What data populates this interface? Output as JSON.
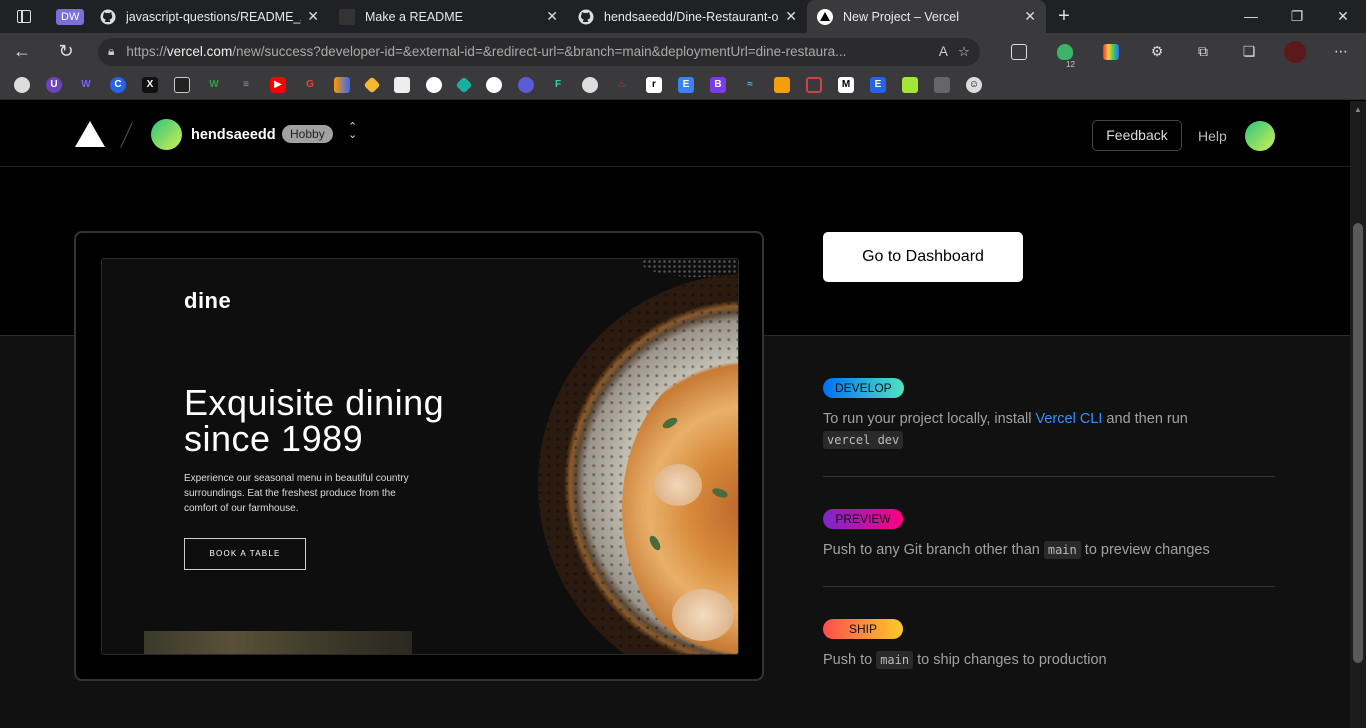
{
  "browser": {
    "tabs": [
      {
        "label": "DW",
        "kind": "workspace"
      },
      {
        "label": "javascript-questions/README_AR",
        "icon": "github-icon"
      },
      {
        "label": "Make a README",
        "icon": "page-icon"
      },
      {
        "label": "hendsaeedd/Dine-Restaurant-on",
        "icon": "github-icon"
      },
      {
        "label": "New Project – Vercel",
        "icon": "vercel-icon",
        "active": true
      }
    ],
    "url_prefix": "https://",
    "url_host": "vercel.com",
    "url_rest": "/new/success?developer-id=&external-id=&redirect-url=&branch=main&deploymentUrl=dine-restaura...",
    "extension_badge": "12"
  },
  "header": {
    "team_name": "hendsaeedd",
    "plan_badge": "Hobby",
    "feedback_label": "Feedback",
    "help_label": "Help"
  },
  "preview": {
    "logo": "dine",
    "title": "Exquisite dining since 1989",
    "description": "Experience our seasonal menu in beautiful country surroundings. Eat the freshest produce from the comfort of our farmhouse.",
    "button": "BOOK A TABLE"
  },
  "dashboard_button": "Go to Dashboard",
  "steps": [
    {
      "badge": "DEVELOP",
      "text_before": "To run your project locally, install ",
      "link": "Vercel CLI",
      "text_after": " and then run ",
      "code": "vercel dev",
      "colors": [
        "#0070f3",
        "#50e3c2"
      ]
    },
    {
      "badge": "PREVIEW",
      "text_before": "Push to any Git branch other than ",
      "code": "main",
      "text_after": " to preview changes",
      "colors": [
        "#7928ca",
        "#ff0080"
      ]
    },
    {
      "badge": "SHIP",
      "text_before": "Push to ",
      "code": "main",
      "text_after": " to ship changes to production",
      "colors": [
        "#ff4d4d",
        "#f9cb28"
      ]
    }
  ]
}
